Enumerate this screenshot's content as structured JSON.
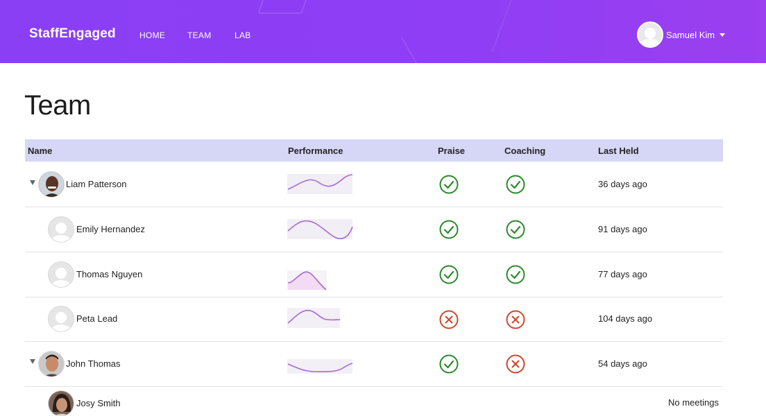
{
  "app": {
    "brand": "StaffEngaged"
  },
  "nav": [
    {
      "label": "HOME"
    },
    {
      "label": "TEAM"
    },
    {
      "label": "LAB"
    }
  ],
  "user": {
    "name": "Samuel Kim",
    "avatar": "user-placeholder-icon"
  },
  "page": {
    "title": "Team"
  },
  "table": {
    "columns": [
      "Name",
      "Performance",
      "Praise",
      "Coaching",
      "Last Held"
    ],
    "rows": [
      {
        "name": "Liam Patterson",
        "avatar": "photo",
        "expandable": true,
        "praise": "check",
        "coaching": "check",
        "last_held": "36 days ago"
      },
      {
        "name": "Emily Hernandez",
        "avatar": "placeholder",
        "expandable": false,
        "praise": "check",
        "coaching": "check",
        "last_held": "91 days ago"
      },
      {
        "name": "Thomas Nguyen",
        "avatar": "placeholder",
        "expandable": false,
        "praise": "check",
        "coaching": "check",
        "last_held": "77 days ago"
      },
      {
        "name": "Peta Lead",
        "avatar": "placeholder",
        "expandable": false,
        "praise": "cross",
        "coaching": "cross",
        "last_held": "104 days ago"
      },
      {
        "name": "John Thomas",
        "avatar": "photo",
        "expandable": true,
        "praise": "check",
        "coaching": "cross",
        "last_held": "54 days ago"
      },
      {
        "name": "Josy Smith",
        "avatar": "photo",
        "expandable": false,
        "praise": "",
        "coaching": "",
        "last_held": "No meetings"
      }
    ]
  },
  "colors": {
    "header_bg": "#8a3ff5",
    "table_header_bg": "#d6d6f6",
    "check": "#2a8a2a",
    "cross": "#d0462c",
    "sparkline": "#a46ad0"
  }
}
